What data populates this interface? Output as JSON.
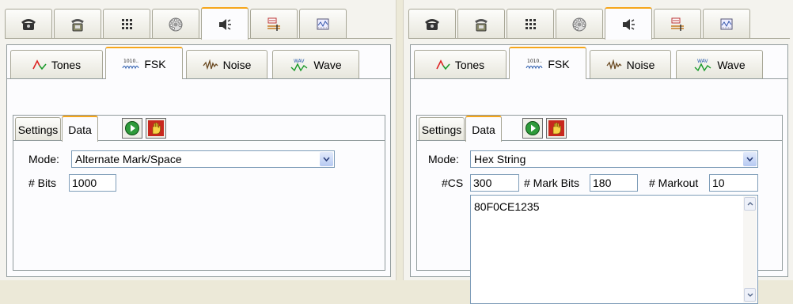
{
  "top_tabs": [
    {
      "icon": "telephone-icon",
      "active": false
    },
    {
      "icon": "desk-phone-icon",
      "active": false
    },
    {
      "icon": "keypad-icon",
      "active": false
    },
    {
      "icon": "rotary-dial-icon",
      "active": false
    },
    {
      "icon": "speaker-icon",
      "active": true
    },
    {
      "icon": "signal-generator-icon",
      "active": false
    },
    {
      "icon": "waveform-screen-icon",
      "active": false
    }
  ],
  "signal_tabs": [
    {
      "label": "Tones",
      "icon": "tones-icon"
    },
    {
      "label": "FSK",
      "icon": "fsk-icon"
    },
    {
      "label": "Noise",
      "icon": "noise-icon"
    },
    {
      "label": "Wave",
      "icon": "wave-icon"
    }
  ],
  "inner_tabs": [
    "Settings",
    "Data"
  ],
  "left": {
    "mode_label": "Mode:",
    "mode_value": "Alternate Mark/Space",
    "bits_label": "# Bits",
    "bits_value": "1000"
  },
  "right": {
    "mode_label": "Mode:",
    "mode_value": "Hex String",
    "cs_label": "#CS",
    "cs_value": "300",
    "mark_bits_label": "# Mark Bits",
    "mark_bits_value": "180",
    "markout_label": "# Markout",
    "markout_value": "10",
    "hex_data": "80F0CE1235"
  },
  "colors": {
    "active_tab_accent": "#f6a61a",
    "input_border": "#7f9db9",
    "play_button": "#2d9a3a"
  }
}
